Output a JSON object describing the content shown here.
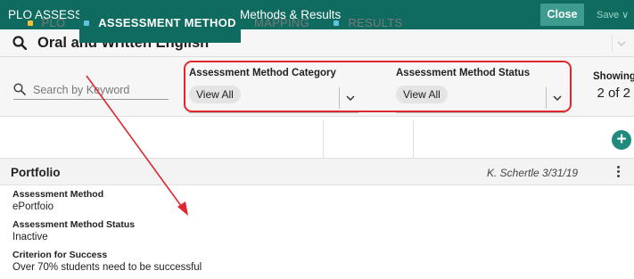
{
  "header": {
    "breadcrumb_root": "PLO ASSESSMENT",
    "breadcrumb_sep": ">",
    "breadcrumb_current": "PLOs, Assessment Methods & Results",
    "close_label": "Close",
    "save_label": "Save ∨"
  },
  "title_row": {
    "title": "Oral and Written English",
    "icon": "search-icon"
  },
  "filters": {
    "search_placeholder": "Search by Keyword",
    "category": {
      "label": "Assessment Method Category",
      "value": "View All"
    },
    "status": {
      "label": "Assessment Method Status",
      "value": "View All"
    },
    "showing_label": "Showing",
    "showing_value": "2 of 2"
  },
  "tabs": [
    {
      "label": "PLO",
      "dot_color": "#f2c230",
      "active": false
    },
    {
      "label": "ASSESSMENT METHOD",
      "dot_color": "#5cc4de",
      "active": true
    },
    {
      "label": "MAPPING",
      "dot_color": null,
      "active": false
    },
    {
      "label": "RESULTS",
      "dot_color": "#5cc4de",
      "active": false
    }
  ],
  "record": {
    "title": "Portfolio",
    "author_date": "K. Schertle 3/31/19",
    "fields": [
      {
        "label": "Assessment Method",
        "value": "ePortfoio"
      },
      {
        "label": "Assessment Method Status",
        "value": "Inactive"
      },
      {
        "label": "Criterion for Success",
        "value": "Over 70% students need to be successful"
      }
    ]
  },
  "colors": {
    "brand": "#0f6b5f",
    "highlight": "#e0262f",
    "add_button": "#1f8a7d"
  }
}
